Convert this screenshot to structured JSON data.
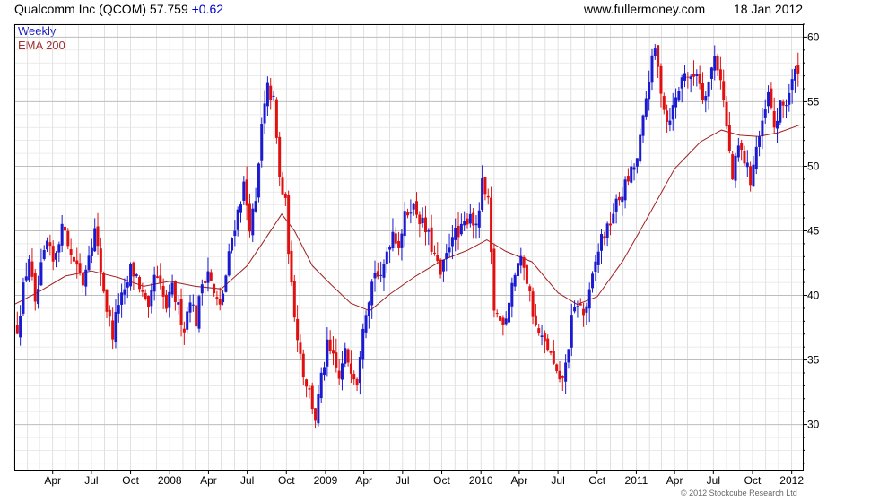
{
  "header": {
    "title": "Qualcomm Inc (QCOM) 57.759",
    "change": "+0.62",
    "site": "www.fullermoney.com",
    "date": "18 Jan 2012"
  },
  "legend": {
    "period": "Weekly",
    "indicator": "EMA 200"
  },
  "footer": {
    "copyright": "© 2012 Stockcube Research Ltd"
  },
  "colors": {
    "up_bar": "#1a1ad0",
    "down_bar": "#e01010",
    "ema_line": "#a02020",
    "grid": "#d4d4d4"
  },
  "chart_data": {
    "type": "ohlc_bar",
    "title": "Qualcomm Inc (QCOM) 57.759 +0.62",
    "period": "Weekly",
    "yaxis": {
      "side": "right",
      "ylim": [
        26.5,
        61
      ],
      "ticks": [
        30,
        35,
        40,
        45,
        50,
        55,
        60
      ]
    },
    "xaxis": {
      "range": [
        "2007-01-01",
        "2012-01-27"
      ],
      "tick_labels": [
        {
          "date": "2007-04-01",
          "label": "Apr"
        },
        {
          "date": "2007-07-01",
          "label": "Jul"
        },
        {
          "date": "2007-10-01",
          "label": "Oct"
        },
        {
          "date": "2008-01-01",
          "label": "2008"
        },
        {
          "date": "2008-04-01",
          "label": "Apr"
        },
        {
          "date": "2008-07-01",
          "label": "Jul"
        },
        {
          "date": "2008-10-01",
          "label": "Oct"
        },
        {
          "date": "2009-01-01",
          "label": "2009"
        },
        {
          "date": "2009-04-01",
          "label": "Apr"
        },
        {
          "date": "2009-07-01",
          "label": "Jul"
        },
        {
          "date": "2009-10-01",
          "label": "Oct"
        },
        {
          "date": "2010-01-01",
          "label": "2010"
        },
        {
          "date": "2010-04-01",
          "label": "Apr"
        },
        {
          "date": "2010-07-01",
          "label": "Jul"
        },
        {
          "date": "2010-10-01",
          "label": "Oct"
        },
        {
          "date": "2011-01-01",
          "label": "2011"
        },
        {
          "date": "2011-04-01",
          "label": "Apr"
        },
        {
          "date": "2011-07-01",
          "label": "Jul"
        },
        {
          "date": "2011-10-01",
          "label": "Oct"
        },
        {
          "date": "2012-01-01",
          "label": "2012"
        }
      ]
    },
    "series": [
      {
        "name": "Weekly",
        "kind": "price",
        "points": [
          [
            "2007-01-08",
            37.5
          ],
          [
            "2007-01-22",
            40.5
          ],
          [
            "2007-02-05",
            43
          ],
          [
            "2007-02-19",
            39
          ],
          [
            "2007-03-05",
            42
          ],
          [
            "2007-03-19",
            44
          ],
          [
            "2007-04-02",
            42.5
          ],
          [
            "2007-04-16",
            44.5
          ],
          [
            "2007-04-30",
            45.5
          ],
          [
            "2007-05-14",
            43
          ],
          [
            "2007-05-28",
            42.5
          ],
          [
            "2007-06-11",
            41
          ],
          [
            "2007-06-25",
            43.5
          ],
          [
            "2007-07-09",
            45
          ],
          [
            "2007-07-23",
            42
          ],
          [
            "2007-08-06",
            39
          ],
          [
            "2007-08-20",
            37
          ],
          [
            "2007-09-03",
            39.5
          ],
          [
            "2007-09-17",
            40
          ],
          [
            "2007-10-01",
            42
          ],
          [
            "2007-10-15",
            41.5
          ],
          [
            "2007-10-29",
            40
          ],
          [
            "2007-11-12",
            38.5
          ],
          [
            "2007-11-26",
            41.5
          ],
          [
            "2007-12-10",
            40.5
          ],
          [
            "2007-12-24",
            39
          ],
          [
            "2008-01-07",
            40.5
          ],
          [
            "2008-01-21",
            39
          ],
          [
            "2008-02-04",
            37.5
          ],
          [
            "2008-02-18",
            40
          ],
          [
            "2008-03-03",
            38
          ],
          [
            "2008-03-17",
            41
          ],
          [
            "2008-03-31",
            42
          ],
          [
            "2008-04-14",
            40
          ],
          [
            "2008-04-28",
            39
          ],
          [
            "2008-05-12",
            41.5
          ],
          [
            "2008-05-26",
            44.5
          ],
          [
            "2008-06-09",
            46.5
          ],
          [
            "2008-06-23",
            48.5
          ],
          [
            "2008-07-07",
            45.5
          ],
          [
            "2008-07-21",
            47
          ],
          [
            "2008-08-04",
            53
          ],
          [
            "2008-08-18",
            56
          ],
          [
            "2008-09-01",
            55
          ],
          [
            "2008-09-15",
            49
          ],
          [
            "2008-09-29",
            47
          ],
          [
            "2008-10-13",
            40.5
          ],
          [
            "2008-10-27",
            37
          ],
          [
            "2008-11-10",
            34
          ],
          [
            "2008-11-24",
            32.5
          ],
          [
            "2008-12-08",
            30.5
          ],
          [
            "2008-12-22",
            33.5
          ],
          [
            "2009-01-05",
            36
          ],
          [
            "2009-01-19",
            35
          ],
          [
            "2009-02-02",
            33.5
          ],
          [
            "2009-02-16",
            35.5
          ],
          [
            "2009-03-02",
            34.5
          ],
          [
            "2009-03-16",
            33.5
          ],
          [
            "2009-03-30",
            38
          ],
          [
            "2009-04-13",
            40
          ],
          [
            "2009-04-27",
            42
          ],
          [
            "2009-05-11",
            41
          ],
          [
            "2009-05-25",
            43.5
          ],
          [
            "2009-06-08",
            45
          ],
          [
            "2009-06-22",
            44
          ],
          [
            "2009-07-06",
            46
          ],
          [
            "2009-07-20",
            47
          ],
          [
            "2009-08-03",
            46.5
          ],
          [
            "2009-08-17",
            45.5
          ],
          [
            "2009-08-31",
            44.5
          ],
          [
            "2009-09-14",
            43
          ],
          [
            "2009-09-28",
            41.5
          ],
          [
            "2009-10-12",
            43
          ],
          [
            "2009-10-26",
            45
          ],
          [
            "2009-11-09",
            44.5
          ],
          [
            "2009-11-23",
            45.5
          ],
          [
            "2009-12-07",
            46.5
          ],
          [
            "2009-12-21",
            45
          ],
          [
            "2010-01-04",
            48.5
          ],
          [
            "2010-01-18",
            47
          ],
          [
            "2010-02-01",
            39
          ],
          [
            "2010-02-15",
            38
          ],
          [
            "2010-03-01",
            38.5
          ],
          [
            "2010-03-15",
            41
          ],
          [
            "2010-03-29",
            42.5
          ],
          [
            "2010-04-12",
            42.5
          ],
          [
            "2010-04-26",
            40
          ],
          [
            "2010-05-10",
            37.5
          ],
          [
            "2010-05-24",
            36.5
          ],
          [
            "2010-06-07",
            36
          ],
          [
            "2010-06-21",
            34.5
          ],
          [
            "2010-07-05",
            33
          ],
          [
            "2010-07-19",
            34.5
          ],
          [
            "2010-08-02",
            38
          ],
          [
            "2010-08-16",
            39.5
          ],
          [
            "2010-08-30",
            38.5
          ],
          [
            "2010-09-13",
            40
          ],
          [
            "2010-09-27",
            42.5
          ],
          [
            "2010-10-11",
            44.5
          ],
          [
            "2010-10-25",
            45
          ],
          [
            "2010-11-08",
            46.5
          ],
          [
            "2010-11-22",
            47.5
          ],
          [
            "2010-12-06",
            48.5
          ],
          [
            "2010-12-20",
            49.5
          ],
          [
            "2011-01-03",
            50.5
          ],
          [
            "2011-01-17",
            53.5
          ],
          [
            "2011-01-31",
            57
          ],
          [
            "2011-02-14",
            59
          ],
          [
            "2011-02-28",
            56
          ],
          [
            "2011-03-14",
            53.5
          ],
          [
            "2011-03-28",
            54.5
          ],
          [
            "2011-04-11",
            56
          ],
          [
            "2011-04-25",
            57.5
          ],
          [
            "2011-05-09",
            56.5
          ],
          [
            "2011-05-23",
            57.5
          ],
          [
            "2011-06-06",
            55.5
          ],
          [
            "2011-06-20",
            56.5
          ],
          [
            "2011-07-04",
            58.5
          ],
          [
            "2011-07-18",
            57
          ],
          [
            "2011-08-01",
            53
          ],
          [
            "2011-08-15",
            49
          ],
          [
            "2011-08-29",
            51.5
          ],
          [
            "2011-09-12",
            50.5
          ],
          [
            "2011-09-26",
            49
          ],
          [
            "2011-10-10",
            51.5
          ],
          [
            "2011-10-24",
            53
          ],
          [
            "2011-11-07",
            55.5
          ],
          [
            "2011-11-21",
            53
          ],
          [
            "2011-12-05",
            54.5
          ],
          [
            "2011-12-19",
            55
          ],
          [
            "2012-01-02",
            56.5
          ],
          [
            "2012-01-16",
            57.76
          ]
        ]
      },
      {
        "name": "EMA 200",
        "kind": "line",
        "points": [
          [
            "2007-01-01",
            39.3
          ],
          [
            "2007-03-01",
            40.3
          ],
          [
            "2007-05-01",
            41.5
          ],
          [
            "2007-07-01",
            41.9
          ],
          [
            "2007-09-01",
            41.4
          ],
          [
            "2007-11-01",
            40.7
          ],
          [
            "2008-01-01",
            41.1
          ],
          [
            "2008-03-01",
            40.7
          ],
          [
            "2008-05-01",
            40.5
          ],
          [
            "2008-07-01",
            42.3
          ],
          [
            "2008-08-15",
            44.5
          ],
          [
            "2008-09-20",
            46.3
          ],
          [
            "2008-10-20",
            45
          ],
          [
            "2008-12-01",
            42.3
          ],
          [
            "2009-01-15",
            40.8
          ],
          [
            "2009-03-01",
            39.4
          ],
          [
            "2009-04-15",
            38.8
          ],
          [
            "2009-06-01",
            40.1
          ],
          [
            "2009-08-01",
            41.5
          ],
          [
            "2009-10-01",
            42.7
          ],
          [
            "2009-12-01",
            43.5
          ],
          [
            "2010-01-15",
            44.3
          ],
          [
            "2010-03-01",
            43.4
          ],
          [
            "2010-05-01",
            42.6
          ],
          [
            "2010-07-01",
            40.2
          ],
          [
            "2010-08-15",
            39.3
          ],
          [
            "2010-10-01",
            39.9
          ],
          [
            "2010-12-01",
            42.7
          ],
          [
            "2011-02-01",
            46.3
          ],
          [
            "2011-04-01",
            49.8
          ],
          [
            "2011-06-01",
            51.9
          ],
          [
            "2011-07-20",
            52.8
          ],
          [
            "2011-09-01",
            52.4
          ],
          [
            "2011-10-15",
            52.3
          ],
          [
            "2011-12-01",
            52.6
          ],
          [
            "2012-01-20",
            53.2
          ]
        ]
      }
    ]
  }
}
